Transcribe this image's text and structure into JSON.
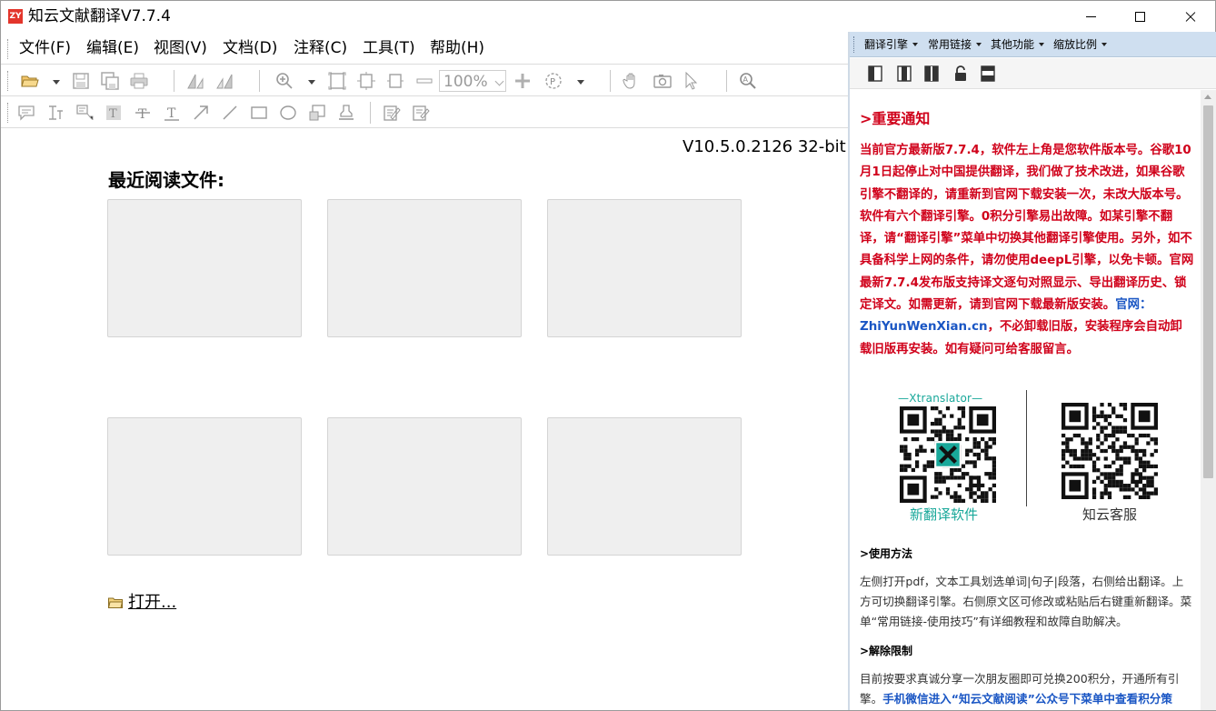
{
  "window": {
    "title": "知云文献翻译V7.7.4",
    "logo_text": "ZY"
  },
  "menubar": {
    "items": [
      "文件(F)",
      "编辑(E)",
      "视图(V)",
      "文档(D)",
      "注释(C)",
      "工具(T)",
      "帮助(H)"
    ]
  },
  "toolbar": {
    "zoom_value": "100%"
  },
  "main": {
    "version": "V10.5.0.2126 32-bit",
    "recent_title": "最近阅读文件:",
    "open_label": "打开..."
  },
  "right_panel": {
    "menu": [
      "翻译引擎",
      "常用链接",
      "其他功能",
      "缩放比例"
    ],
    "notice_title": ">重要通知",
    "notice_part1": "当前官方最新版7.7.4，软件左上角是您软件版本号。谷歌10月1日起停止对中国提供翻译，我们做了技术改进，如果谷歌引擎不翻译的，请重新到官网下载安装一次，未改大版本号。软件有六个翻译引擎。0积分引擎易出故障。如某引擎不翻译，请“翻译引擎”菜单中切换其他翻译引擎使用。另外，如不具备科学上网的条件，请勿使用deepL引擎，以免卡顿。官网最新7.7.4发布版支持译文逐句对照显示、导出翻译历史、锁定译文。如需更新，请到官网下载最新版安装。",
    "notice_site": "官网：ZhiYunWenXian.cn",
    "notice_part2": "，不必卸载旧版，安装程序会自动卸载旧版再安装。如有疑问可给客服留言。",
    "qr_top_label": "—Xtranslator—",
    "qr_left_label": "新翻译软件",
    "qr_right_label": "知云客服",
    "usage_title": ">使用方法",
    "usage_text": "左侧打开pdf，文本工具划选单词|句子|段落，右侧给出翻译。上方可切换翻译引擎。右侧原文区可修改或粘贴后右键重新翻译。菜单“常用链接-使用技巧”有详细教程和故障自助解决。",
    "unlock_title": ">解除限制",
    "unlock_text": "目前按要求真诚分享一次朋友圈即可兑换200积分，开通所有引擎。",
    "unlock_link": "手机微信进入“知云文献阅读”公众号下菜单中查看积分策"
  },
  "colors": {
    "notice_red": "#d0021b",
    "link_blue": "#1a56c4",
    "panel_menu_bg": "#cfdff0",
    "qr_accent": "#19a89a"
  }
}
